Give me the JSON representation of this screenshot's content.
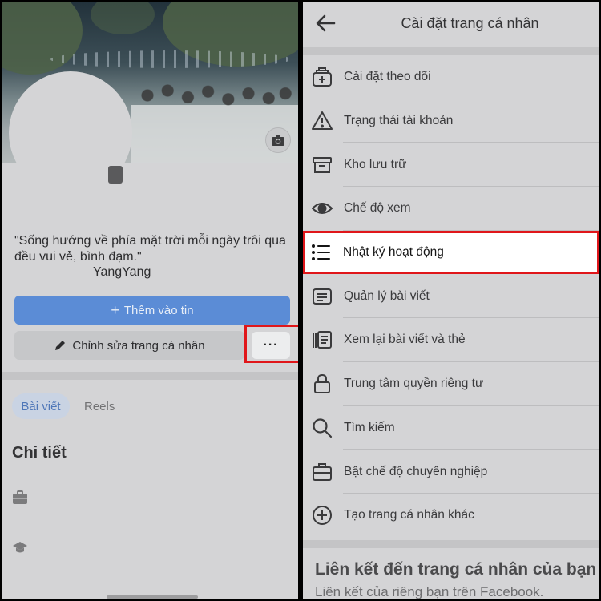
{
  "profile": {
    "bio": "\"Sống hướng về phía mặt trời mỗi ngày trôi qua đều vui vẻ, bình đạm.\"",
    "bio_author": "YangYang",
    "add_story_label": "Thêm vào tin",
    "edit_profile_label": "Chỉnh sửa trang cá nhân",
    "more_label": "···",
    "tabs": [
      {
        "label": "Bài viết",
        "selected": true
      },
      {
        "label": "Reels",
        "selected": false
      }
    ],
    "details_title": "Chi tiết",
    "detail_icons": [
      "briefcase-icon",
      "graduation-cap-icon"
    ]
  },
  "settings": {
    "title": "Cài đặt trang cá nhân",
    "items": [
      {
        "label": "Cài đặt theo dõi",
        "icon": "follow-settings-icon"
      },
      {
        "label": "Trạng thái tài khoản",
        "icon": "warning-icon"
      },
      {
        "label": "Kho lưu trữ",
        "icon": "archive-icon"
      },
      {
        "label": "Chế độ xem",
        "icon": "eye-icon"
      },
      {
        "label": "Nhật ký hoạt động",
        "icon": "list-icon",
        "highlighted": true
      },
      {
        "label": "Quản lý bài viết",
        "icon": "posts-icon"
      },
      {
        "label": "Xem lại bài viết và thẻ",
        "icon": "review-tags-icon"
      },
      {
        "label": "Trung tâm quyền riêng tư",
        "icon": "lock-icon"
      },
      {
        "label": "Tìm kiếm",
        "icon": "search-icon"
      },
      {
        "label": "Bật chế độ chuyên nghiệp",
        "icon": "briefcase-icon"
      },
      {
        "label": "Tạo trang cá nhân khác",
        "icon": "plus-circle-icon"
      }
    ],
    "link_section": {
      "title": "Liên kết đến trang cá nhân của bạn",
      "subtitle": "Liên kết của riêng bạn trên Facebook."
    }
  },
  "colors": {
    "highlight_border": "#e0161a",
    "primary_button": "#5b8cd6",
    "overlay_bg": "#d4d4d6"
  }
}
